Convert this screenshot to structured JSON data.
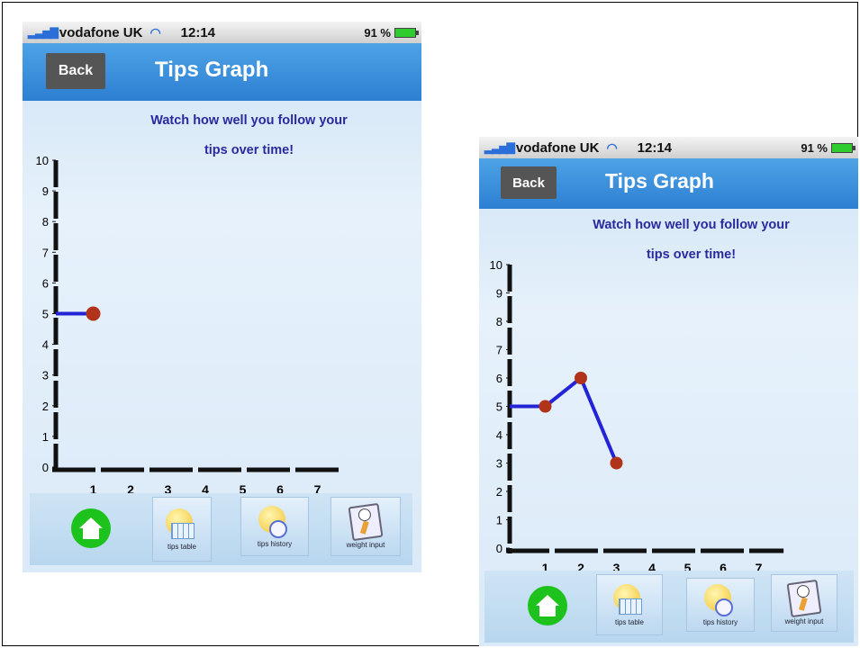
{
  "status_bar": {
    "carrier": "vodafone UK",
    "time": "12:14",
    "battery": "91 %"
  },
  "nav": {
    "back_label": "Back",
    "title": "Tips Graph"
  },
  "subtitle_line1": "Watch how well you follow your",
  "subtitle_line2": "tips over time!",
  "tabs": [
    {
      "label": "",
      "icon": "home-icon"
    },
    {
      "label": "tips table",
      "icon": "tips-table-icon"
    },
    {
      "label": "tips history",
      "icon": "tips-history-icon"
    },
    {
      "label": "weight input",
      "icon": "weight-input-icon"
    }
  ],
  "colors": {
    "line": "#2323d8",
    "marker": "#b0331a",
    "nav": "#2d7fd2",
    "title_text": "#2a2a9e"
  },
  "chart_data": [
    {
      "type": "line",
      "title": "",
      "xlabel": "",
      "ylabel": "",
      "x_ticks": [
        1,
        2,
        3,
        4,
        5,
        6,
        7
      ],
      "y_ticks": [
        0,
        1,
        2,
        3,
        4,
        5,
        6,
        7,
        8,
        9,
        10
      ],
      "ylim": [
        0,
        10
      ],
      "series": [
        {
          "x": [
            1
          ],
          "y": [
            5
          ]
        }
      ]
    },
    {
      "type": "line",
      "title": "",
      "xlabel": "",
      "ylabel": "",
      "x_ticks": [
        1,
        2,
        3,
        4,
        5,
        6,
        7
      ],
      "y_ticks": [
        0,
        1,
        2,
        3,
        4,
        5,
        6,
        7,
        8,
        9,
        10
      ],
      "ylim": [
        0,
        10
      ],
      "series": [
        {
          "x": [
            1,
            2,
            3
          ],
          "y": [
            5,
            6,
            3
          ]
        }
      ]
    }
  ]
}
